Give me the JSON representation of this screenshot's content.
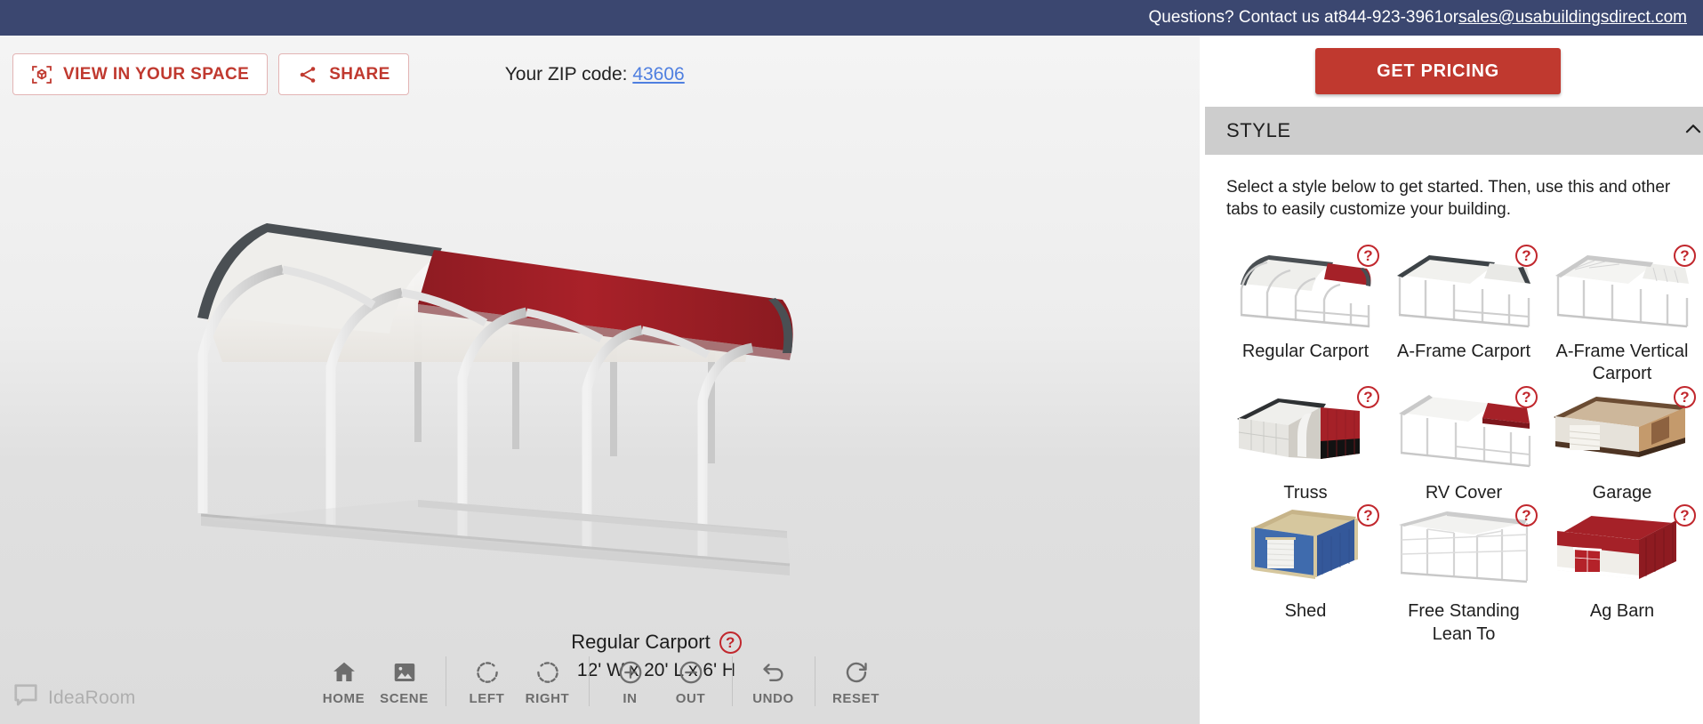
{
  "topbar": {
    "text_before": "Questions? Contact us at ",
    "phone": "844-923-3961",
    "text_middle": " or ",
    "email": "sales@usabuildingsdirect.com"
  },
  "viewer_controls": {
    "view_in_space_label": "VIEW IN YOUR SPACE",
    "share_label": "SHARE",
    "zip_label": "Your ZIP code:",
    "zip_value": "43606"
  },
  "model": {
    "name": "Regular Carport",
    "dimensions": "12' W x 20' L x 6' H",
    "help_glyph": "?",
    "roof_color": "#a52128",
    "frame_color": "#d9d9d9",
    "trim_color": "#4a4f53"
  },
  "toolbar": {
    "groups": [
      {
        "items": [
          {
            "label": "HOME",
            "icon": "home-icon"
          },
          {
            "label": "SCENE",
            "icon": "scene-image-icon"
          }
        ]
      },
      {
        "items": [
          {
            "label": "LEFT",
            "icon": "rotate-left-icon"
          },
          {
            "label": "RIGHT",
            "icon": "rotate-right-icon"
          }
        ]
      },
      {
        "items": [
          {
            "label": "IN",
            "icon": "zoom-in-icon"
          },
          {
            "label": "OUT",
            "icon": "zoom-out-icon"
          }
        ]
      },
      {
        "items": [
          {
            "label": "UNDO",
            "icon": "undo-icon"
          }
        ]
      },
      {
        "items": [
          {
            "label": "RESET",
            "icon": "reset-icon"
          }
        ]
      }
    ]
  },
  "brand": {
    "name": "IdeaRoom"
  },
  "panel": {
    "get_pricing_label": "GET PRICING",
    "accordion_title": "STYLE",
    "accordion_state": "expanded",
    "help_text": "Select a style below to get started. Then, use this and other tabs to easily customize your building.",
    "help_glyph": "?",
    "styles": [
      {
        "label": "Regular Carport",
        "icon": "regular-carport-thumb"
      },
      {
        "label": "A-Frame Carport",
        "icon": "a-frame-carport-thumb"
      },
      {
        "label": "A-Frame Vertical Carport",
        "icon": "a-frame-vertical-carport-thumb"
      },
      {
        "label": "Truss",
        "icon": "truss-thumb"
      },
      {
        "label": "RV Cover",
        "icon": "rv-cover-thumb"
      },
      {
        "label": "Garage",
        "icon": "garage-thumb"
      },
      {
        "label": "Shed",
        "icon": "shed-thumb"
      },
      {
        "label": "Free Standing Lean To",
        "icon": "free-standing-lean-to-thumb"
      },
      {
        "label": "Ag Barn",
        "icon": "ag-barn-thumb"
      }
    ]
  },
  "colors": {
    "topbar_bg": "#3b4770",
    "accent_red": "#c0392f",
    "help_red": "#c1272d",
    "link_blue": "#4f7fe0",
    "accordion_bg": "#cdcdcd"
  }
}
